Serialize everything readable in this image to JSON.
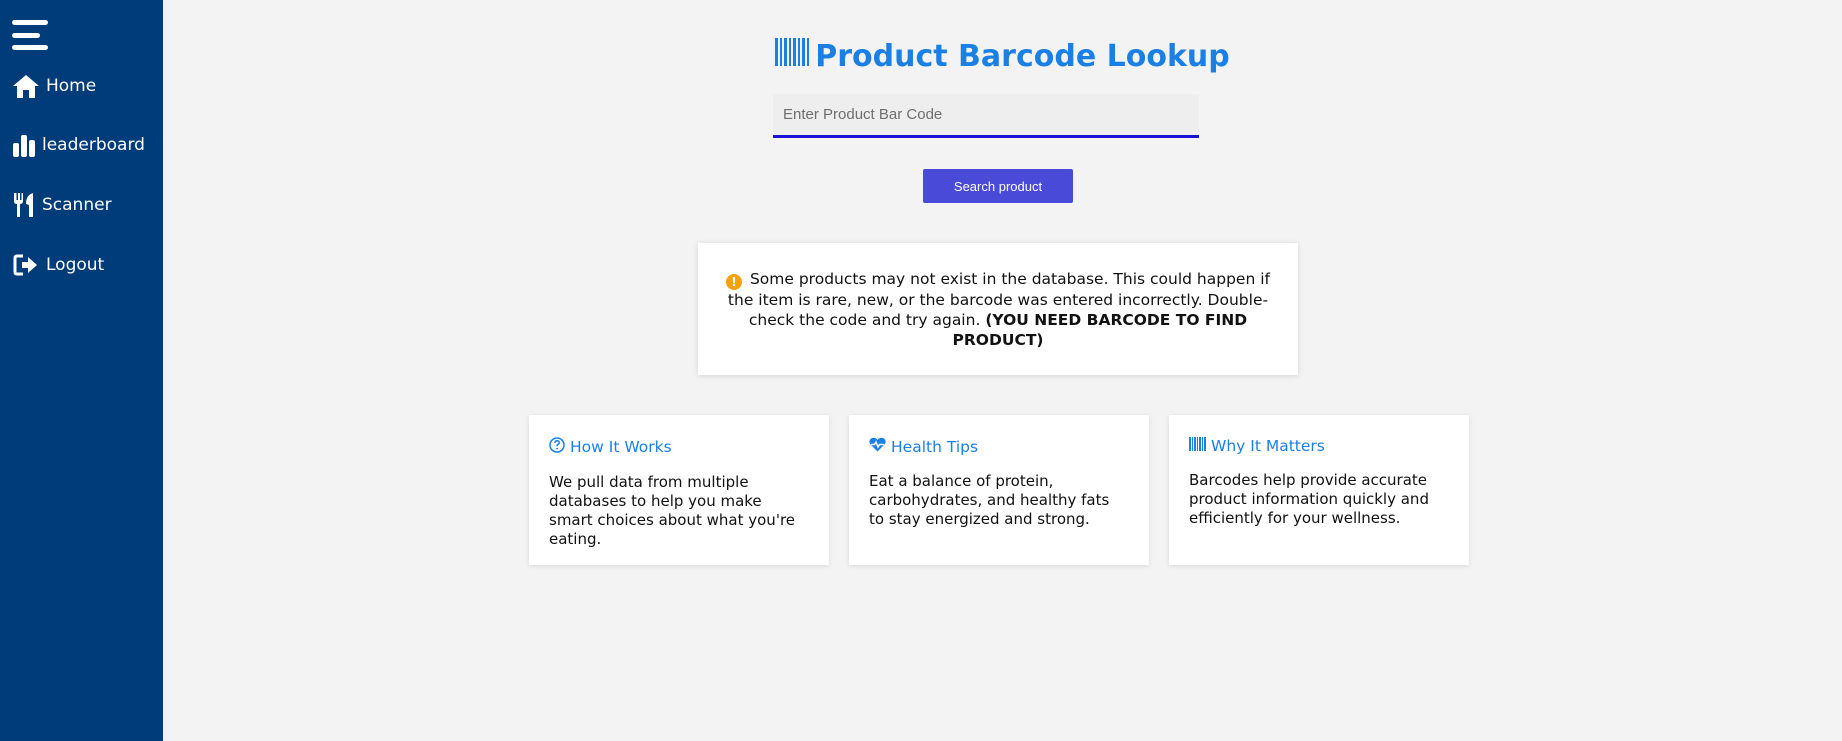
{
  "sidebar": {
    "menu_icon": "hamburger-menu-icon",
    "items": [
      {
        "label": "Home",
        "icon": "home-icon"
      },
      {
        "label": "leaderboard",
        "icon": "bar-chart-icon"
      },
      {
        "label": "Scanner",
        "icon": "utensils-icon"
      },
      {
        "label": "Logout",
        "icon": "logout-icon"
      }
    ]
  },
  "header": {
    "title": "Product Barcode Lookup",
    "icon": "barcode-icon"
  },
  "search": {
    "placeholder": "Enter Product Bar Code",
    "value": "",
    "button_label": "Search product"
  },
  "notice": {
    "icon": "warning-icon",
    "text": "Some products may not exist in the database. This could happen if the item is rare, new, or the barcode was entered incorrectly. Double-check the code and try again.",
    "emphasis": "(YOU NEED BARCODE TO FIND PRODUCT)"
  },
  "cards": [
    {
      "title": "How It Works",
      "icon": "question-circle-icon",
      "text": "We pull data from multiple databases to help you make smart choices about what you're eating."
    },
    {
      "title": "Health Tips",
      "icon": "heartbeat-icon",
      "text": "Eat a balance of protein, carbohydrates, and healthy fats to stay energized and strong."
    },
    {
      "title": "Why It Matters",
      "icon": "barcode-icon",
      "text": "Barcodes help provide accurate product information quickly and efficiently for your wellness."
    }
  ],
  "colors": {
    "sidebar_bg": "#003b7a",
    "accent": "#1a80e6",
    "button_bg": "#4a4ad8",
    "input_underline": "#1a12d6",
    "warning": "#f5a10c",
    "page_bg": "#f3f3f3"
  }
}
